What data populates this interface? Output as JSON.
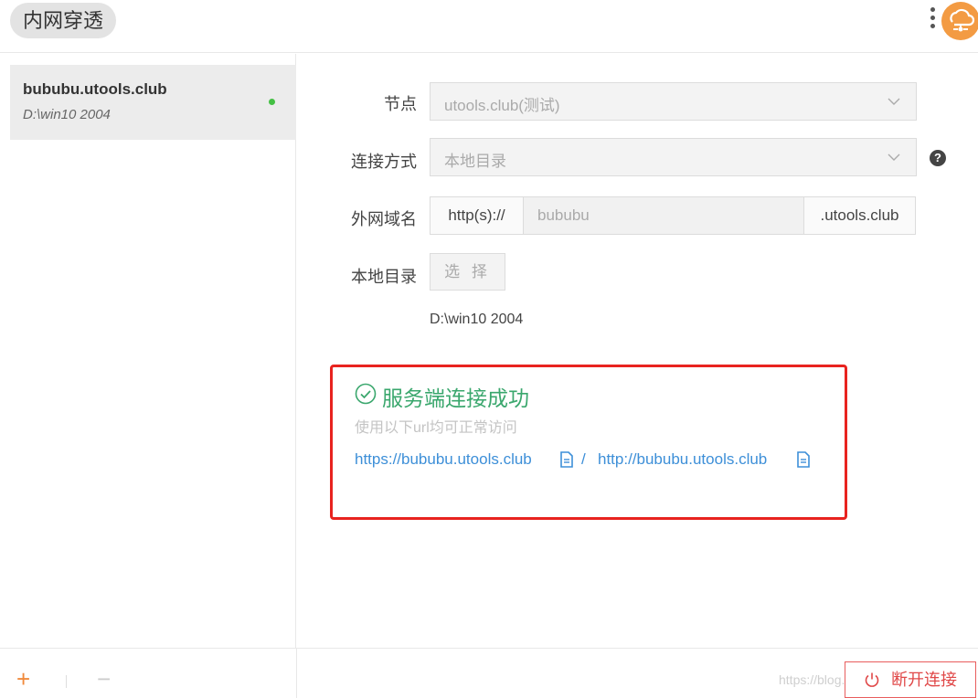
{
  "header": {
    "title": "内网穿透",
    "more_icon": "more-vertical-icon",
    "logo_icon": "cloud-tunnel-icon",
    "logo_color": "#f39b43"
  },
  "sidebar": {
    "items": [
      {
        "name": "bububu.utools.club",
        "path": "D:\\win10 2004",
        "status": "connected",
        "status_color": "#44c044"
      }
    ]
  },
  "form": {
    "node_label": "节点",
    "node_value": "utools.club(测试)",
    "connection_label": "连接方式",
    "connection_value": "本地目录",
    "domain_label": "外网域名",
    "domain_prefix": "http(s)://",
    "domain_value": "bububu",
    "domain_suffix": ".utools.club",
    "dir_label": "本地目录",
    "choose_button": "选 择",
    "dir_value": "D:\\win10 2004"
  },
  "result": {
    "title": "服务端连接成功",
    "subtitle": "使用以下url均可正常访问",
    "https_url": "https://bububu.utools.club",
    "separator": "/",
    "http_url": "http://bububu.utools.club",
    "success_color": "#3aa76d",
    "highlight_color": "#e8231f"
  },
  "footer": {
    "add_label": "+",
    "remove_label": "−",
    "disconnect_label": "断开连接",
    "watermark": "https://blog.csdn.net/qq_"
  }
}
